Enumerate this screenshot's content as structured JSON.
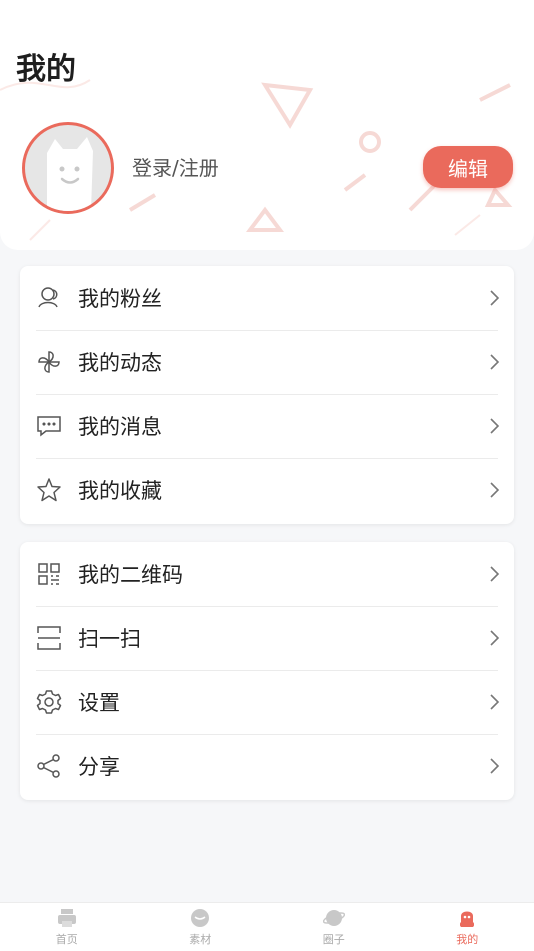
{
  "header": {
    "title": "我的",
    "login_text": "登录/注册",
    "edit_label": "编辑",
    "accent": "#ea6a5c"
  },
  "menu_group_1": [
    {
      "label": "我的粉丝",
      "icon": "fans-icon"
    },
    {
      "label": "我的动态",
      "icon": "pinwheel-icon"
    },
    {
      "label": "我的消息",
      "icon": "message-icon"
    },
    {
      "label": "我的收藏",
      "icon": "star-icon"
    }
  ],
  "menu_group_2": [
    {
      "label": "我的二维码",
      "icon": "qrcode-icon"
    },
    {
      "label": "扫一扫",
      "icon": "scan-icon"
    },
    {
      "label": "设置",
      "icon": "gear-icon"
    },
    {
      "label": "分享",
      "icon": "share-icon"
    }
  ],
  "tabbar": {
    "tabs": [
      {
        "label": "首页",
        "icon": "home-icon",
        "active": false
      },
      {
        "label": "素材",
        "icon": "material-icon",
        "active": false
      },
      {
        "label": "圈子",
        "icon": "planet-icon",
        "active": false
      },
      {
        "label": "我的",
        "icon": "profile-icon",
        "active": true
      }
    ]
  }
}
